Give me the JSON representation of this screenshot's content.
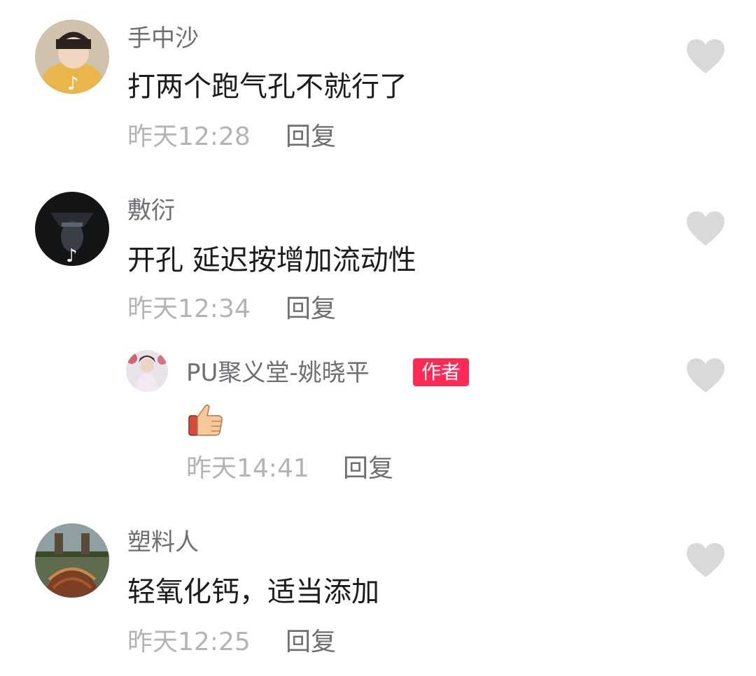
{
  "comments": [
    {
      "username": "手中沙",
      "text": "打两个跑气孔不就行了",
      "time": "昨天12:28",
      "reply_label": "回复"
    },
    {
      "username": "敷衍",
      "text": "开孔 延迟按增加流动性",
      "time": "昨天12:34",
      "reply_label": "回复",
      "replies": [
        {
          "username": "PU聚义堂-姚晓平",
          "badge": "作者",
          "text_emoji": "thumbs-up",
          "time": "昨天14:41",
          "reply_label": "回复"
        }
      ]
    },
    {
      "username": "塑料人",
      "text": "轻氧化钙，适当添加",
      "time": "昨天12:25",
      "reply_label": "回复"
    }
  ],
  "icons": {
    "like": "heart-icon",
    "avatar_badge": "tiktok-logo-icon"
  },
  "colors": {
    "author_badge": "#fe2c55",
    "like_icon": "#d9d9d9"
  }
}
